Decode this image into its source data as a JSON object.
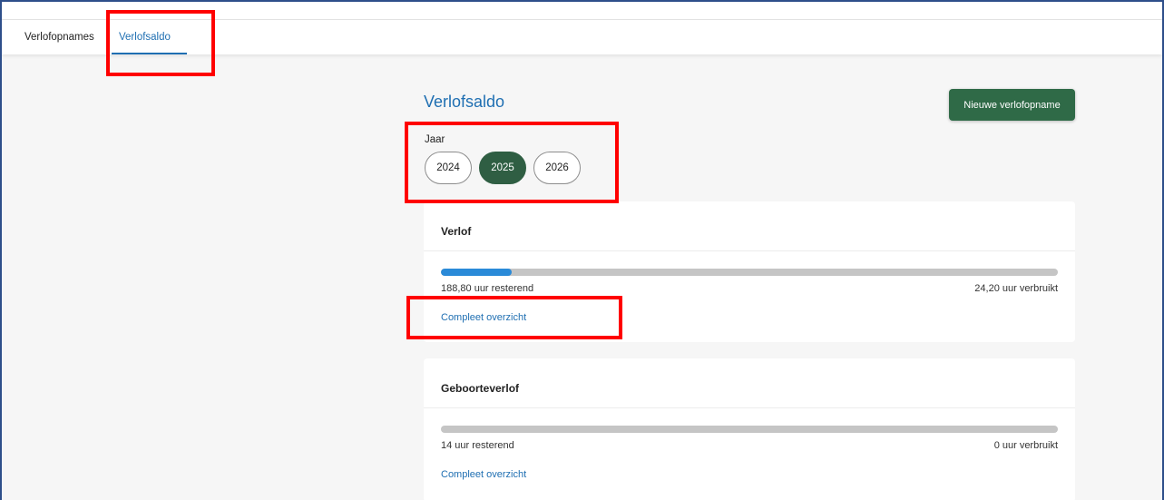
{
  "tabs": [
    {
      "label": "Verlofopnames",
      "active": false
    },
    {
      "label": "Verlofsaldo",
      "active": true
    }
  ],
  "header": {
    "title": "Verlofsaldo",
    "new_button_label": "Nieuwe verlofopname"
  },
  "year_selector": {
    "label": "Jaar",
    "options": [
      "2024",
      "2025",
      "2026"
    ],
    "selected": "2025"
  },
  "cards": [
    {
      "title": "Verlof",
      "progress_fraction": 0.114,
      "remaining": "188,80 uur resterend",
      "used": "24,20 uur verbruikt",
      "link": "Compleet overzicht"
    },
    {
      "title": "Geboorteverlof",
      "progress_fraction": 0,
      "remaining": "14 uur resterend",
      "used": "0 uur verbruikt",
      "link": "Compleet overzicht"
    }
  ],
  "colors": {
    "accent_blue": "#1f6fb2",
    "primary_green": "#2f6a47",
    "progress_blue": "#2a8ad8",
    "highlight_red": "#ff0000"
  }
}
